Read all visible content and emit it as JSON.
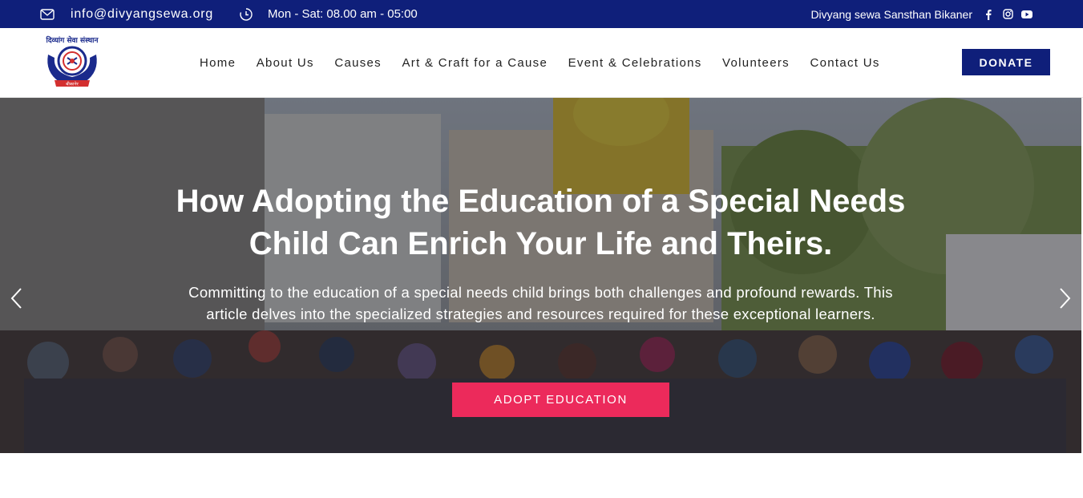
{
  "topbar": {
    "email": "info@divyangsewa.org",
    "hours": "Mon - Sat: 08.00 am - 05:00",
    "org_name": "Divyang sewa Sansthan Bikaner",
    "icons": [
      "mail-icon",
      "clock-icon",
      "facebook-icon",
      "instagram-icon",
      "youtube-icon"
    ]
  },
  "header": {
    "logo_top_text": "दिव्यांग सेवा संस्थान",
    "logo_bottom_text": "बीकानेर",
    "nav": [
      "Home",
      "About Us",
      "Causes",
      "Art & Craft for a Cause",
      "Event & Celebrations",
      "Volunteers",
      "Contact Us"
    ],
    "donate_label": "DONATE"
  },
  "hero": {
    "title": "How Adopting the Education of a Special Needs Child Can Enrich Your Life and Theirs.",
    "description": "Committing to the education of a special needs child brings both challenges and profound rewards. This article delves into the specialized strategies and resources required for these exceptional learners.",
    "cta_label": "ADOPT EDUCATION"
  },
  "colors": {
    "brand_navy": "#0f1f7a",
    "cta_pink": "#ec2a5b"
  }
}
